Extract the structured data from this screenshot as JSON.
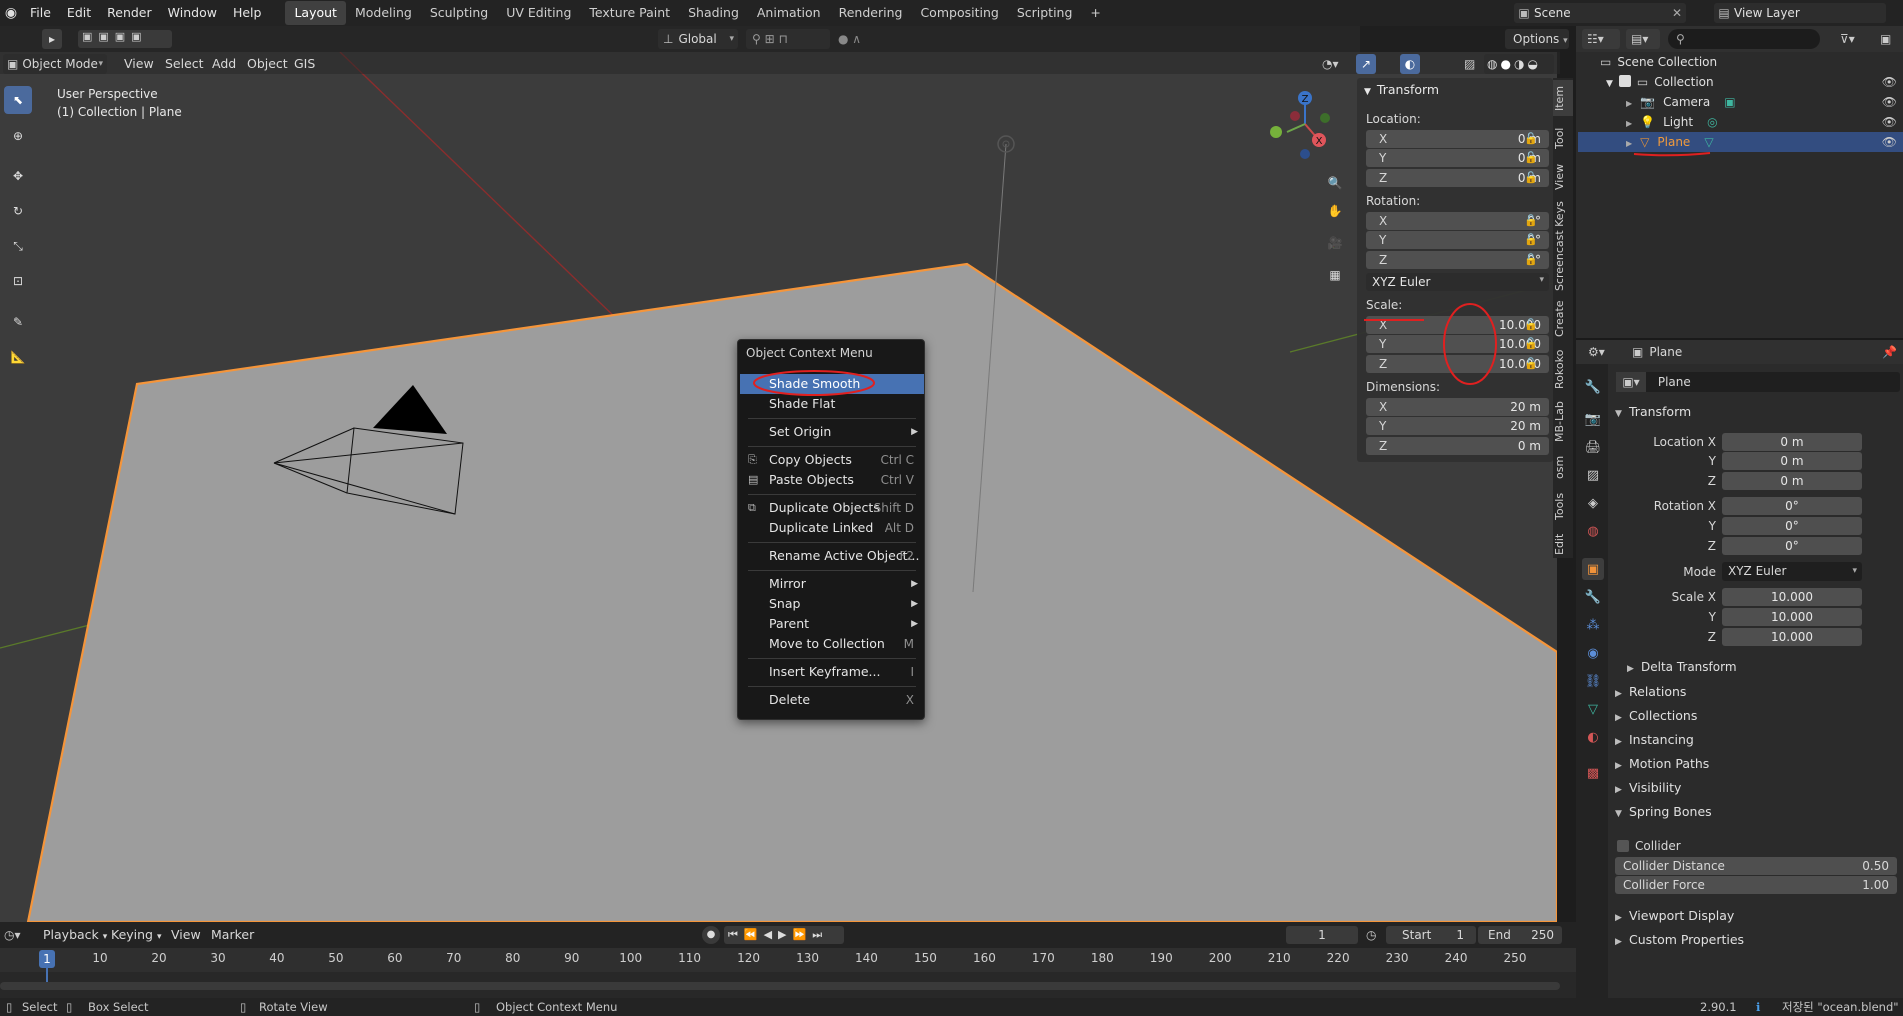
{
  "topbar": {
    "menus": [
      "File",
      "Edit",
      "Render",
      "Window",
      "Help"
    ],
    "workspaces": [
      "Layout",
      "Modeling",
      "Sculpting",
      "UV Editing",
      "Texture Paint",
      "Shading",
      "Animation",
      "Rendering",
      "Compositing",
      "Scripting"
    ],
    "active_workspace": "Layout",
    "add_ws": "+",
    "scene": "Scene",
    "view_layer": "View Layer"
  },
  "viewport_header": {
    "mode": "Object Mode",
    "menus": [
      "View",
      "Select",
      "Add",
      "Object",
      "GIS"
    ],
    "orientation": "Global",
    "options": "Options"
  },
  "viewport": {
    "perspective": "User Perspective",
    "collection": "(1) Collection | Plane"
  },
  "gizmo": {
    "z": "Z",
    "x": "X"
  },
  "context_menu": {
    "title": "Object Context Menu",
    "items": [
      {
        "label": "Shade Smooth",
        "shortcut": "",
        "submenu": false,
        "highlight": true
      },
      {
        "label": "Shade Flat",
        "shortcut": "",
        "submenu": false
      },
      {
        "label": "Set Origin",
        "shortcut": "",
        "submenu": true
      },
      {
        "label": "Copy Objects",
        "shortcut": "Ctrl C",
        "submenu": false,
        "icon": "copy-icon"
      },
      {
        "label": "Paste Objects",
        "shortcut": "Ctrl V",
        "submenu": false,
        "icon": "paste-icon"
      },
      {
        "label": "Duplicate Objects",
        "shortcut": "Shift D",
        "submenu": false,
        "icon": "duplicate-icon"
      },
      {
        "label": "Duplicate Linked",
        "shortcut": "Alt D",
        "submenu": false
      },
      {
        "label": "Rename Active Object...",
        "shortcut": "F2",
        "submenu": false
      },
      {
        "label": "Mirror",
        "shortcut": "",
        "submenu": true
      },
      {
        "label": "Snap",
        "shortcut": "",
        "submenu": true
      },
      {
        "label": "Parent",
        "shortcut": "",
        "submenu": true
      },
      {
        "label": "Move to Collection",
        "shortcut": "M",
        "submenu": false
      },
      {
        "label": "Insert Keyframe...",
        "shortcut": "I",
        "submenu": false
      },
      {
        "label": "Delete",
        "shortcut": "X",
        "submenu": false
      }
    ]
  },
  "npanel": {
    "title": "Transform",
    "location_label": "Location:",
    "location": [
      "0 m",
      "0 m",
      "0 m"
    ],
    "rotation_label": "Rotation:",
    "rotation": [
      "0°",
      "0°",
      "0°"
    ],
    "rotation_mode": "XYZ Euler",
    "scale_label": "Scale:",
    "scale": [
      "10.000",
      "10.000",
      "10.000"
    ],
    "dimensions_label": "Dimensions:",
    "dimensions": [
      "20 m",
      "20 m",
      "0 m"
    ],
    "axes": [
      "X",
      "Y",
      "Z"
    ],
    "tabs": [
      "Item",
      "Tool",
      "View",
      "Screencast Keys",
      "Create",
      "Rokoko",
      "MB-Lab",
      "osm",
      "Tools",
      "Edit"
    ]
  },
  "outliner": {
    "root": "Scene Collection",
    "items": [
      "Collection",
      "Camera",
      "Light",
      "Plane"
    ],
    "selected": "Plane"
  },
  "properties": {
    "header": "Plane",
    "object_name": "Plane",
    "transform_title": "Transform",
    "location_labels": [
      "Location X",
      "Y",
      "Z"
    ],
    "location": [
      "0 m",
      "0 m",
      "0 m"
    ],
    "rotation_labels": [
      "Rotation X",
      "Y",
      "Z"
    ],
    "rotation": [
      "0°",
      "0°",
      "0°"
    ],
    "mode_label": "Mode",
    "mode": "XYZ Euler",
    "scale_labels": [
      "Scale X",
      "Y",
      "Z"
    ],
    "scale": [
      "10.000",
      "10.000",
      "10.000"
    ],
    "delta": "Delta Transform",
    "sections": [
      "Relations",
      "Collections",
      "Instancing",
      "Motion Paths",
      "Visibility"
    ],
    "spring": "Spring Bones",
    "collider": "Collider",
    "collider_distance_label": "Collider Distance",
    "collider_distance": "0.50",
    "collider_force_label": "Collider Force",
    "collider_force": "1.00",
    "sections2": [
      "Viewport Display",
      "Custom Properties"
    ]
  },
  "timeline": {
    "menus": [
      "Playback",
      "Keying",
      "View",
      "Marker"
    ],
    "current": "1",
    "start_label": "Start",
    "start": "1",
    "end_label": "End",
    "end": "250",
    "ticks": [
      "1",
      "10",
      "20",
      "30",
      "40",
      "50",
      "60",
      "70",
      "80",
      "90",
      "100",
      "110",
      "120",
      "130",
      "140",
      "150",
      "160",
      "170",
      "180",
      "190",
      "200",
      "210",
      "220",
      "230",
      "240",
      "250"
    ]
  },
  "statusbar": {
    "select": "Select",
    "box": "Box Select",
    "rotate": "Rotate View",
    "context": "Object Context Menu",
    "version": "2.90.1",
    "saved": "저장된 \"ocean.blend\""
  }
}
